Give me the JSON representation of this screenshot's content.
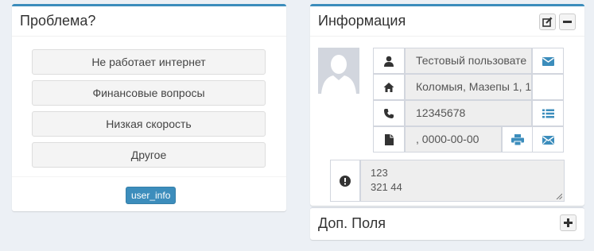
{
  "problem_box": {
    "title": "Проблема?",
    "options": [
      {
        "label": "Не работает интернет"
      },
      {
        "label": "Финансовые вопросы"
      },
      {
        "label": "Низкая скорость"
      },
      {
        "label": "Другое"
      }
    ],
    "footer_button": "user_info"
  },
  "info_box": {
    "title": "Информация",
    "tools": {
      "edit_icon": "edit-icon",
      "collapse_icon": "minus-icon"
    },
    "avatar_icon": "user-silhouette",
    "name_value": "Тестовый пользовате",
    "address_value": "Коломыя, Мазепы 1, 1",
    "phone_value": "12345678",
    "contract_value": ", 0000-00-00",
    "note_lines": [
      "123",
      "321 44"
    ]
  },
  "extra_box": {
    "title": "Доп. Поля",
    "expand_icon": "plus-icon"
  },
  "colors": {
    "accent": "#3c8dbc",
    "background": "#ecf0f5",
    "icon_dark": "#333333"
  }
}
